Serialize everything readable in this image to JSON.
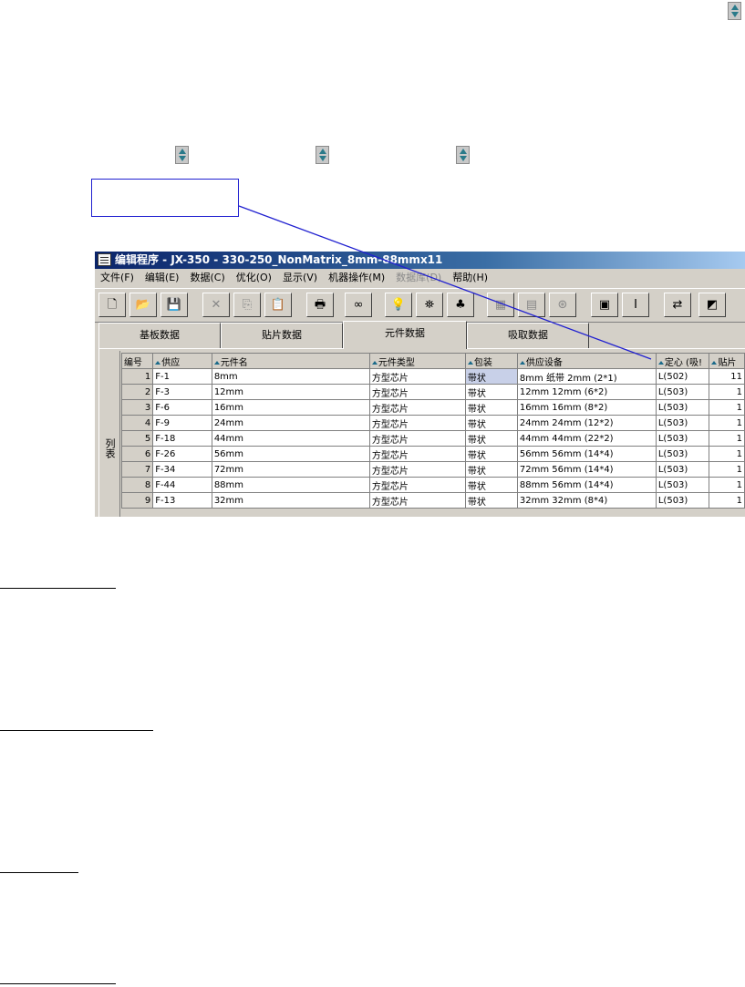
{
  "window": {
    "title": "编辑程序 - JX-350 - 330-250_NonMatrix_8mm-88mmx11"
  },
  "menu": [
    {
      "label": "文件(F)",
      "disabled": false
    },
    {
      "label": "编辑(E)",
      "disabled": false
    },
    {
      "label": "数据(C)",
      "disabled": false
    },
    {
      "label": "优化(O)",
      "disabled": false
    },
    {
      "label": "显示(V)",
      "disabled": false
    },
    {
      "label": "机器操作(M)",
      "disabled": false
    },
    {
      "label": "数据库(D)",
      "disabled": true
    },
    {
      "label": "帮助(H)",
      "disabled": false
    }
  ],
  "toolbar": [
    {
      "icon": "new-file-icon",
      "glyph": "🗋",
      "dim": false
    },
    {
      "icon": "open-folder-icon",
      "glyph": "📂",
      "dim": false
    },
    {
      "icon": "save-icon",
      "glyph": "💾",
      "dim": false
    },
    {
      "icon": "cut-icon",
      "glyph": "✕",
      "dim": true
    },
    {
      "icon": "copy-icon",
      "glyph": "⎘",
      "dim": true
    },
    {
      "icon": "paste-icon",
      "glyph": "📋",
      "dim": true
    },
    {
      "icon": "print-icon",
      "glyph": "🖶",
      "dim": false
    },
    {
      "icon": "find-icon",
      "glyph": "∞",
      "dim": false
    },
    {
      "icon": "lightbulb-icon",
      "glyph": "💡",
      "dim": false
    },
    {
      "icon": "machine-icon",
      "glyph": "⛯",
      "dim": false
    },
    {
      "icon": "optimize-icon",
      "glyph": "♣",
      "dim": false
    },
    {
      "icon": "board-icon",
      "glyph": "▦",
      "dim": true
    },
    {
      "icon": "feeder-icon",
      "glyph": "▤",
      "dim": true
    },
    {
      "icon": "nozzle-icon",
      "glyph": "⊛",
      "dim": true
    },
    {
      "icon": "component-icon",
      "glyph": "▣",
      "dim": false
    },
    {
      "icon": "ibeam-icon",
      "glyph": "Ⅰ",
      "dim": false
    },
    {
      "icon": "transfer-icon",
      "glyph": "⇄",
      "dim": false
    },
    {
      "icon": "export-icon",
      "glyph": "◩",
      "dim": false
    }
  ],
  "tabs": [
    "基板数据",
    "贴片数据",
    "元件数据",
    "吸取数据"
  ],
  "active_tab": 2,
  "sidebar_label": "列表",
  "table": {
    "columns": [
      {
        "label": "编号",
        "sort": false
      },
      {
        "label": "供应",
        "sort": true
      },
      {
        "label": "元件名",
        "sort": true
      },
      {
        "label": "元件类型",
        "sort": true
      },
      {
        "label": "包装",
        "sort": true
      },
      {
        "label": "供应设备",
        "sort": true
      },
      {
        "label": "定心 (吸!",
        "sort": true
      },
      {
        "label": "贴片",
        "sort": true
      }
    ],
    "rows": [
      [
        "1",
        "F-1",
        "8mm",
        "方型芯片",
        "带状",
        "8mm 纸带 2mm (2*1)",
        "L(502)",
        "11"
      ],
      [
        "2",
        "F-3",
        "12mm",
        "方型芯片",
        "带状",
        "12mm 12mm (6*2)",
        "L(503)",
        "1"
      ],
      [
        "3",
        "F-6",
        "16mm",
        "方型芯片",
        "带状",
        "16mm 16mm (8*2)",
        "L(503)",
        "1"
      ],
      [
        "4",
        "F-9",
        "24mm",
        "方型芯片",
        "带状",
        "24mm 24mm (12*2)",
        "L(503)",
        "1"
      ],
      [
        "5",
        "F-18",
        "44mm",
        "方型芯片",
        "带状",
        "44mm 44mm (22*2)",
        "L(503)",
        "1"
      ],
      [
        "6",
        "F-26",
        "56mm",
        "方型芯片",
        "带状",
        "56mm 56mm (14*4)",
        "L(503)",
        "1"
      ],
      [
        "7",
        "F-34",
        "72mm",
        "方型芯片",
        "带状",
        "72mm 56mm (14*4)",
        "L(503)",
        "1"
      ],
      [
        "8",
        "F-44",
        "88mm",
        "方型芯片",
        "带状",
        "88mm 56mm (14*4)",
        "L(503)",
        "1"
      ],
      [
        "9",
        "F-13",
        "32mm",
        "方型芯片",
        "带状",
        "32mm 32mm (8*4)",
        "L(503)",
        "1"
      ]
    ]
  },
  "colors": {
    "callout_line": "#2020d0",
    "title_gradient_start": "#0a246a",
    "selected_cell": "#c8d0e8"
  }
}
